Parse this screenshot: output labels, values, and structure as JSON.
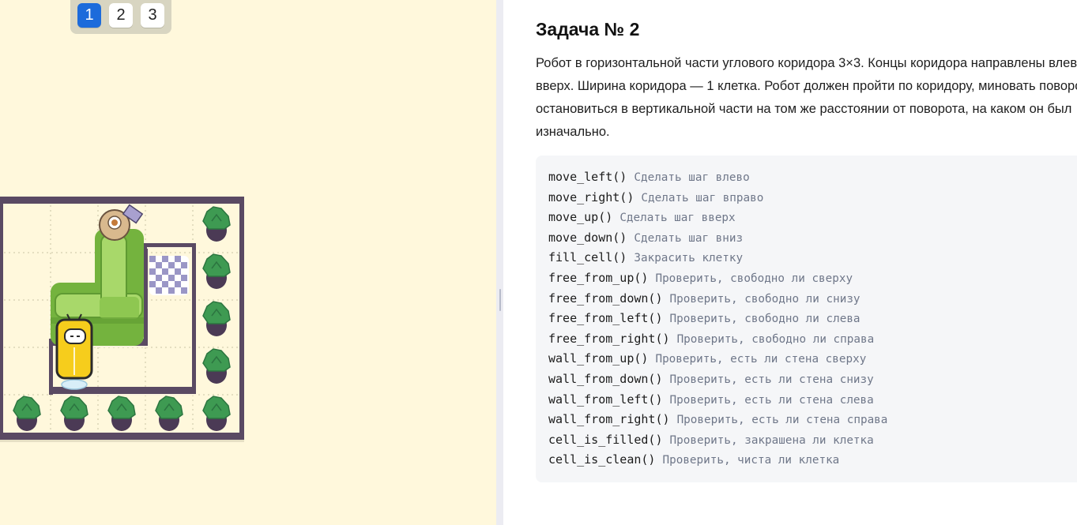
{
  "level_tabs": [
    {
      "label": "1",
      "active": true
    },
    {
      "label": "2",
      "active": false
    },
    {
      "label": "3",
      "active": false
    }
  ],
  "task": {
    "title": "Задача № 2",
    "description_lines": [
      "Робот в горизонтальной части углового коридора 3×3. Концы коридора направлены влево и",
      "вверх. Ширина коридора — 1 клетка. Робот должен пройти по коридору, миновать поворот и",
      "остановиться в вертикальной части на том же расстоянии от поворота, на каком он был",
      "изначально."
    ]
  },
  "commands": [
    {
      "code": "move_left()",
      "desc": "Сделать шаг влево"
    },
    {
      "code": "move_right()",
      "desc": "Сделать шаг вправо"
    },
    {
      "code": "move_up()",
      "desc": "Сделать шаг вверх"
    },
    {
      "code": "move_down()",
      "desc": "Сделать шаг вниз"
    },
    {
      "code": "fill_cell()",
      "desc": "Закрасить клетку"
    },
    {
      "code": "free_from_up()",
      "desc": "Проверить, свободно ли сверху"
    },
    {
      "code": "free_from_down()",
      "desc": "Проверить, свободно ли снизу"
    },
    {
      "code": "free_from_left()",
      "desc": "Проверить, свободно ли слева"
    },
    {
      "code": "free_from_right()",
      "desc": "Проверить, свободно ли справа"
    },
    {
      "code": "wall_from_up()",
      "desc": "Проверить, есть ли стена сверху"
    },
    {
      "code": "wall_from_down()",
      "desc": "Проверить, есть ли стена снизу"
    },
    {
      "code": "wall_from_left()",
      "desc": "Проверить, есть ли стена слева"
    },
    {
      "code": "wall_from_right()",
      "desc": "Проверить, есть ли стена справа"
    },
    {
      "code": "cell_is_filled()",
      "desc": "Проверить, закрашена ли клетка"
    },
    {
      "code": "cell_is_clean()",
      "desc": "Проверить, чиста ли клетка"
    }
  ],
  "board": {
    "rows": 5,
    "cols": 5,
    "robot_cell": {
      "row": 3,
      "col": 1
    },
    "target_cell": {
      "row": 1,
      "col": 3
    },
    "plant_cells": [
      {
        "row": 0,
        "col": 4
      },
      {
        "row": 1,
        "col": 4
      },
      {
        "row": 2,
        "col": 4
      },
      {
        "row": 3,
        "col": 4
      },
      {
        "row": 4,
        "col": 0
      },
      {
        "row": 4,
        "col": 1
      },
      {
        "row": 4,
        "col": 2
      },
      {
        "row": 4,
        "col": 3
      },
      {
        "row": 4,
        "col": 4
      }
    ]
  },
  "colors": {
    "background": "#fff8dc",
    "wall": "#5a4a63",
    "sofa": "#8ec751",
    "robot": "#f6cd1c",
    "plant_leaf": "#3e9a52",
    "pot": "#4b3a55",
    "accent": "#1c6bdb"
  }
}
